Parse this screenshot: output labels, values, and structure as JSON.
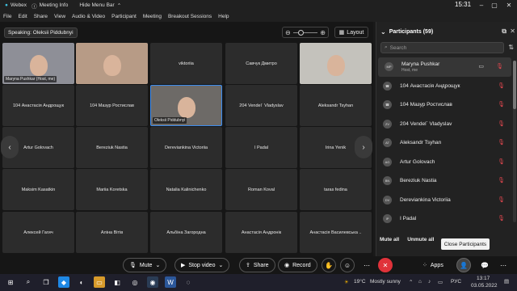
{
  "window": {
    "app_name": "Webex",
    "meeting_info": "Meeting Info",
    "hide_menu": "Hide Menu Bar",
    "time": "15:31"
  },
  "menu": [
    "File",
    "Edit",
    "Share",
    "View",
    "Audio & Video",
    "Participant",
    "Meeting",
    "Breakout Sessions",
    "Help"
  ],
  "stage": {
    "speaking": "Speaking: Oleksii Piddubnyi",
    "layout_label": "Layout",
    "tiles": [
      {
        "name": "Maryna Pushkar (Host, me)",
        "video": true
      },
      {
        "name": "",
        "video": true
      },
      {
        "name": "viktoriia",
        "video": false
      },
      {
        "name": "Савчук Дмитро",
        "video": false
      },
      {
        "name": "",
        "video": true
      },
      {
        "name": "104 Анастасія Андрощук",
        "video": false
      },
      {
        "name": "104 Мазур Ростислав",
        "video": false
      },
      {
        "name": "Oleksii Piddubnyi",
        "video": true,
        "active": true
      },
      {
        "name": "204 Vendel` Vladyslav",
        "video": false
      },
      {
        "name": "Aleksandr Tsyhan",
        "video": false
      },
      {
        "name": "Artur Golovach",
        "video": false
      },
      {
        "name": "Bereziuk Nastia",
        "video": false
      },
      {
        "name": "Dereviankina Victoriia",
        "video": false
      },
      {
        "name": "I Padal",
        "video": false
      },
      {
        "name": "Irina Yenik",
        "video": false
      },
      {
        "name": "Maksim Kasatkin",
        "video": false
      },
      {
        "name": "Mariia Koretska",
        "video": false
      },
      {
        "name": "Natalia Kalinichenko",
        "video": false
      },
      {
        "name": "Roman Koval",
        "video": false
      },
      {
        "name": "taras fedina",
        "video": false
      },
      {
        "name": "Алексей Гагич",
        "video": false
      },
      {
        "name": "Аліна Вітів",
        "video": false
      },
      {
        "name": "Альбіна Загородна",
        "video": false
      },
      {
        "name": "Анастасія Андронік",
        "video": false
      },
      {
        "name": "Анастасія Василевська ..",
        "video": false
      }
    ]
  },
  "participants": {
    "title": "Participants (59)",
    "search_placeholder": "Search",
    "list": [
      {
        "initials": "MP",
        "name": "Maryna Pushkar",
        "sub": "Host, me"
      },
      {
        "initials": "",
        "name": "104 Анастасія Андрощук",
        "sub": ""
      },
      {
        "initials": "",
        "name": "104 Мазур Ростислав",
        "sub": ""
      },
      {
        "initials": "ZV",
        "name": "204 Vendel` Vladyslav",
        "sub": ""
      },
      {
        "initials": "AT",
        "name": "Aleksandr Tsyhan",
        "sub": ""
      },
      {
        "initials": "AG",
        "name": "Artur Golovach",
        "sub": ""
      },
      {
        "initials": "BN",
        "name": "Bereziuk Nastia",
        "sub": ""
      },
      {
        "initials": "DV",
        "name": "Dereviankina Victoriia",
        "sub": ""
      },
      {
        "initials": "IP",
        "name": "I Padal",
        "sub": ""
      },
      {
        "initials": "IY",
        "name": "Irina Yenik",
        "sub": ""
      }
    ],
    "mute_all": "Mute all",
    "unmute_all": "Unmute all",
    "tooltip": "Close Participants"
  },
  "controls": {
    "mute": "Mute",
    "stop_video": "Stop video",
    "share": "Share",
    "record": "Record",
    "apps": "Apps"
  },
  "taskbar": {
    "temperature": "19°C",
    "weather": "Mostly sunny",
    "lang": "РУС",
    "time": "13:17",
    "date": "03.05.2022"
  },
  "colors": {
    "accent": "#3b8cf0",
    "danger": "#e0323a"
  }
}
